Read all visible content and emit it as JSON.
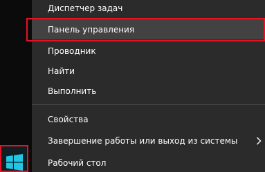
{
  "menu": {
    "items": [
      {
        "label": "Диспетчер задач"
      },
      {
        "label": "Панель управления"
      },
      {
        "label": "Проводник"
      },
      {
        "label": "Найти"
      },
      {
        "label": "Выполнить"
      },
      {
        "label": "Свойства"
      },
      {
        "label": "Завершение работы или выход из системы"
      },
      {
        "label": "Рабочий стол"
      }
    ]
  },
  "icons": {
    "submenu_arrow": "chevron-right-icon",
    "start": "windows-logo-icon"
  },
  "colors": {
    "menu_background": "#2b2b2b",
    "highlight": "#424242",
    "annotation_red": "#e81123",
    "start_logo": "#21c5e6",
    "text": "#ffffff"
  }
}
